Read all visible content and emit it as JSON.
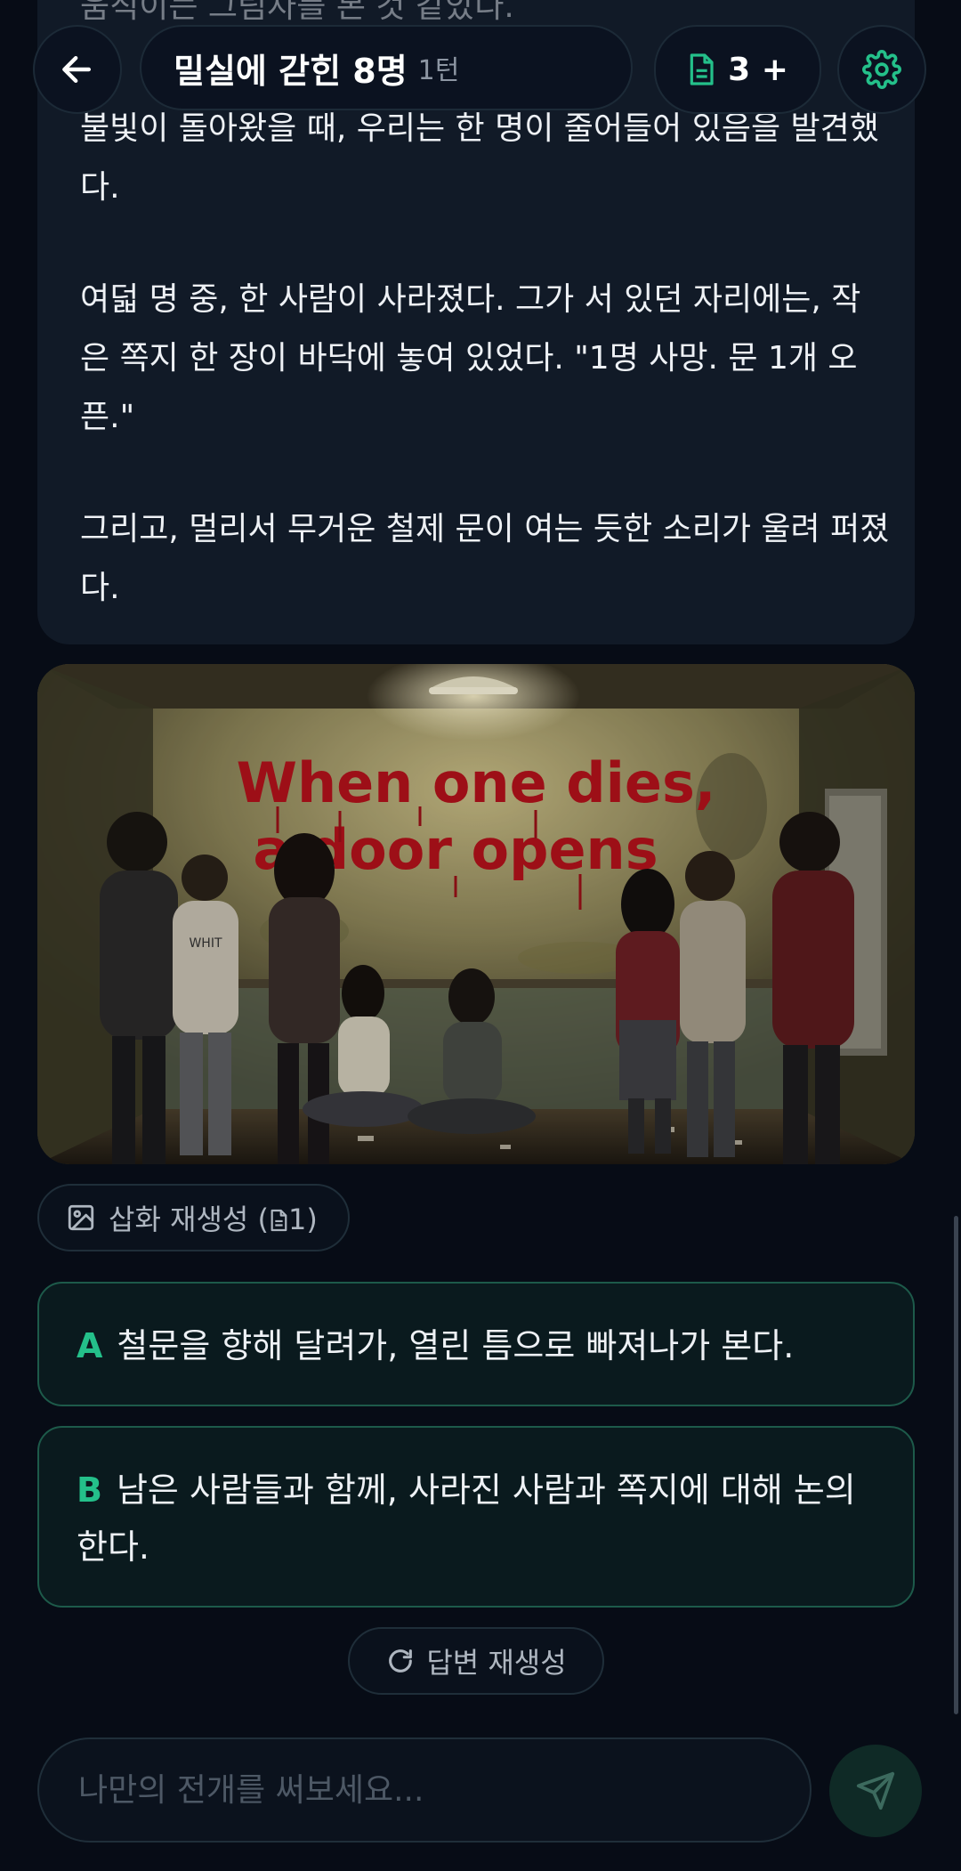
{
  "header": {
    "title": "밀실에 갇힌 8명",
    "turn": "1턴",
    "token_count": "3 +"
  },
  "story": {
    "partial_line": "움직이는 그림자를 본 것 같았다.",
    "paragraphs": [
      "불빛이 돌아왔을 때, 우리는 한 명이 줄어들어 있음을 발견했다.",
      "여덟 명 중, 한 사람이 사라졌다. 그가 서 있던 자리에는, 작은 쪽지 한 장이 바닥에 놓여 있었다. \"1명 사망. 문 1개 오픈.\"",
      "그리고, 멀리서 무거운 철제 문이 여는 듯한 소리가 울려 퍼졌다."
    ]
  },
  "illustration": {
    "wall_text_line1": "When one dies,",
    "wall_text_line2": "a door opens",
    "shirt_text": "WHIT"
  },
  "regen_illustration": {
    "label": "삽화 재생성 (",
    "cost": "1)"
  },
  "choices": [
    {
      "letter": "A",
      "text": "철문을 향해 달려가, 열린 틈으로 빠져나가 본다."
    },
    {
      "letter": "B",
      "text": "남은 사람들과 함께, 사라진 사람과 쪽지에 대해 논의한다."
    }
  ],
  "regen_answer": {
    "label": "답변 재생성"
  },
  "input": {
    "placeholder": "나만의 전개를 써보세요...",
    "value": ""
  },
  "colors": {
    "background": "#070c16",
    "card": "#111a27",
    "accent": "#24c08a",
    "wall_text": "#b3121b"
  },
  "icons": [
    "back-arrow-icon",
    "document-icon",
    "gear-icon",
    "image-icon",
    "refresh-icon",
    "send-icon"
  ]
}
